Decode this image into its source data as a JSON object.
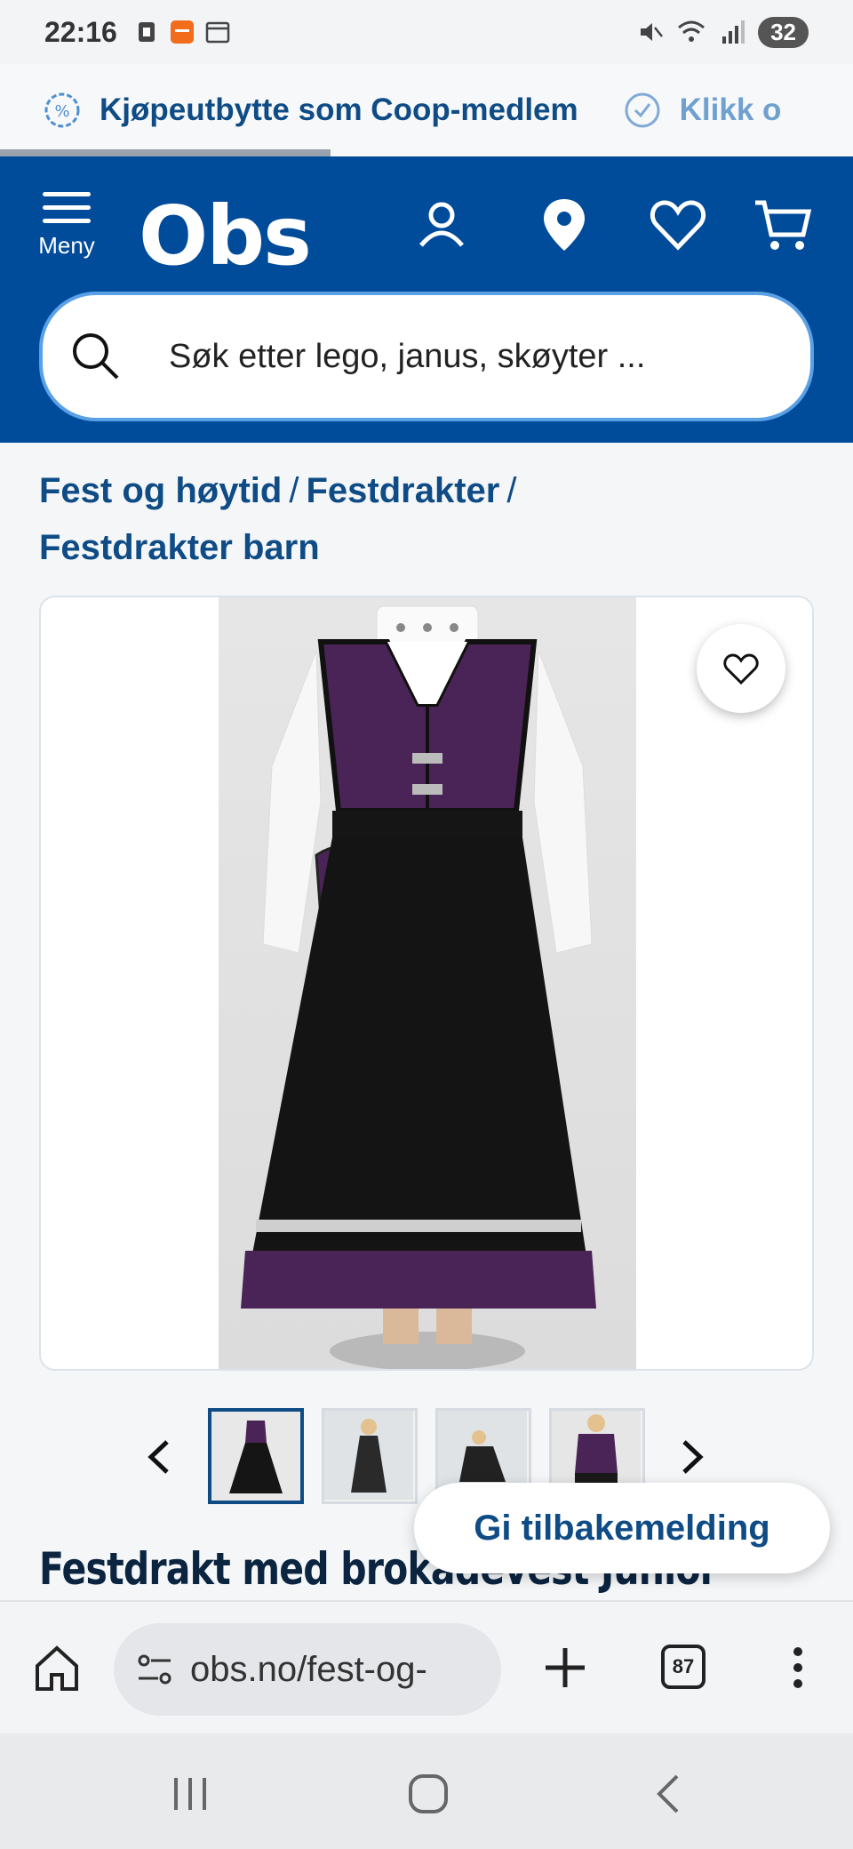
{
  "status_bar": {
    "time": "22:16",
    "battery": "32"
  },
  "promo": [
    {
      "text": "Kjøpeutbytte som Coop-medlem"
    },
    {
      "text": "Klikk o"
    }
  ],
  "header": {
    "menu_label": "Meny",
    "logo": "Obs"
  },
  "search": {
    "placeholder": "Søk etter lego, janus, skøyter ..."
  },
  "breadcrumb": [
    "Fest og høytid",
    "Festdrakter",
    "Festdrakter barn"
  ],
  "product": {
    "title": "Festdrakt med brokadevest Junior"
  },
  "feedback": {
    "label": "Gi tilbakemelding"
  },
  "browser": {
    "url": "obs.no/fest-og-",
    "tab_count": "87"
  },
  "colors": {
    "brand_blue": "#004b9a",
    "link_blue": "#0f4c85",
    "dress_purple": "#4a2456"
  }
}
